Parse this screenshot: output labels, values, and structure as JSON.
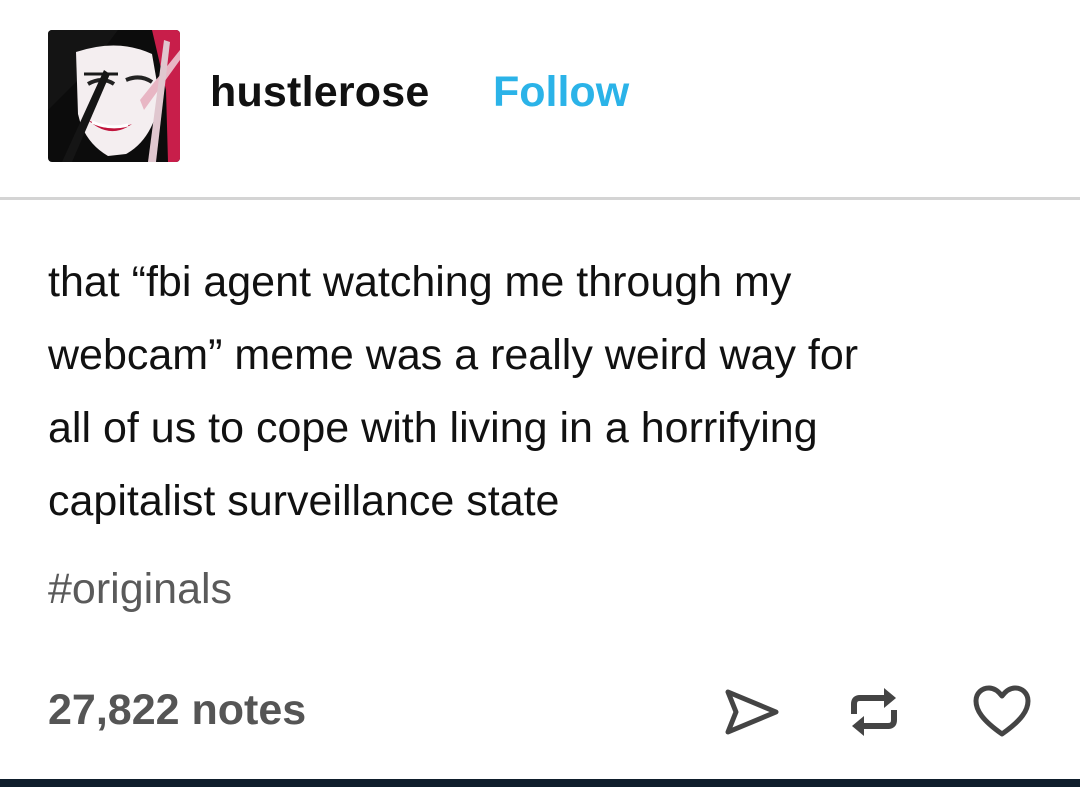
{
  "post": {
    "username": "hustlerose",
    "follow_label": "Follow",
    "body_lines": [
      "that “fbi agent watching me through my",
      "webcam” meme was a really weird way for",
      "all of us to cope with living in a horrifying",
      "capitalist surveillance state"
    ],
    "tag": "#originals",
    "notes": "27,822 notes"
  },
  "icons": {
    "avatar": "avatar-illustration",
    "share": "share-icon",
    "reblog": "reblog-icon",
    "like": "heart-icon"
  },
  "colors": {
    "follow": "#2bb3e8",
    "text": "#111111",
    "tag": "#5a5a5a",
    "notes": "#555555",
    "divider": "#d4d4d4",
    "bottom_bar": "#0f1e2c"
  }
}
